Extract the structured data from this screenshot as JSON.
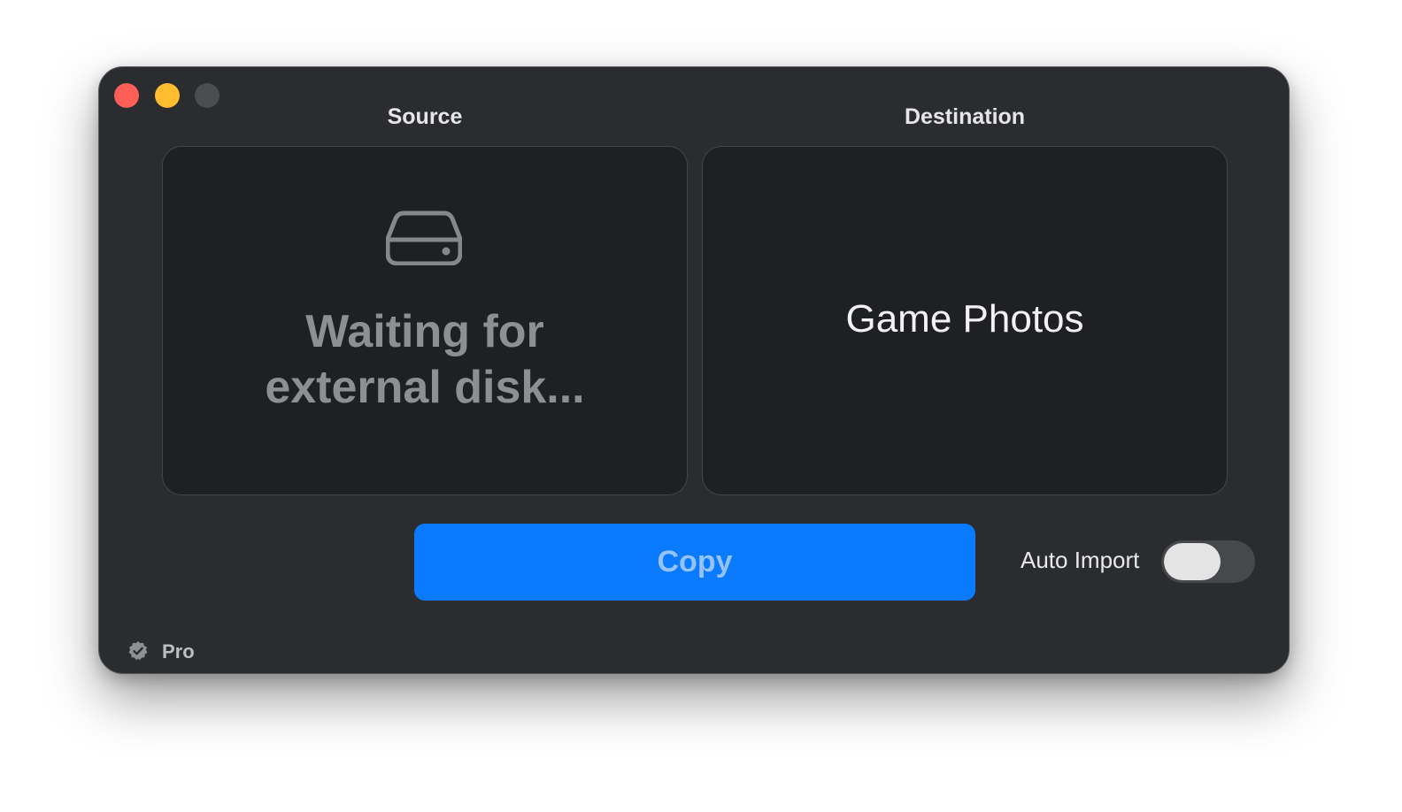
{
  "window": {
    "controls": [
      "close",
      "minimize",
      "zoom"
    ]
  },
  "source": {
    "title": "Source",
    "icon": "external-drive-icon",
    "status": "Waiting for external disk..."
  },
  "destination": {
    "title": "Destination",
    "name": "Game Photos"
  },
  "actions": {
    "copy_label": "Copy",
    "accent_color": "#0a7aff"
  },
  "auto_import": {
    "label": "Auto Import",
    "enabled": false
  },
  "footer": {
    "badge_icon": "checkmark-seal-icon",
    "badge_label": "Pro"
  }
}
